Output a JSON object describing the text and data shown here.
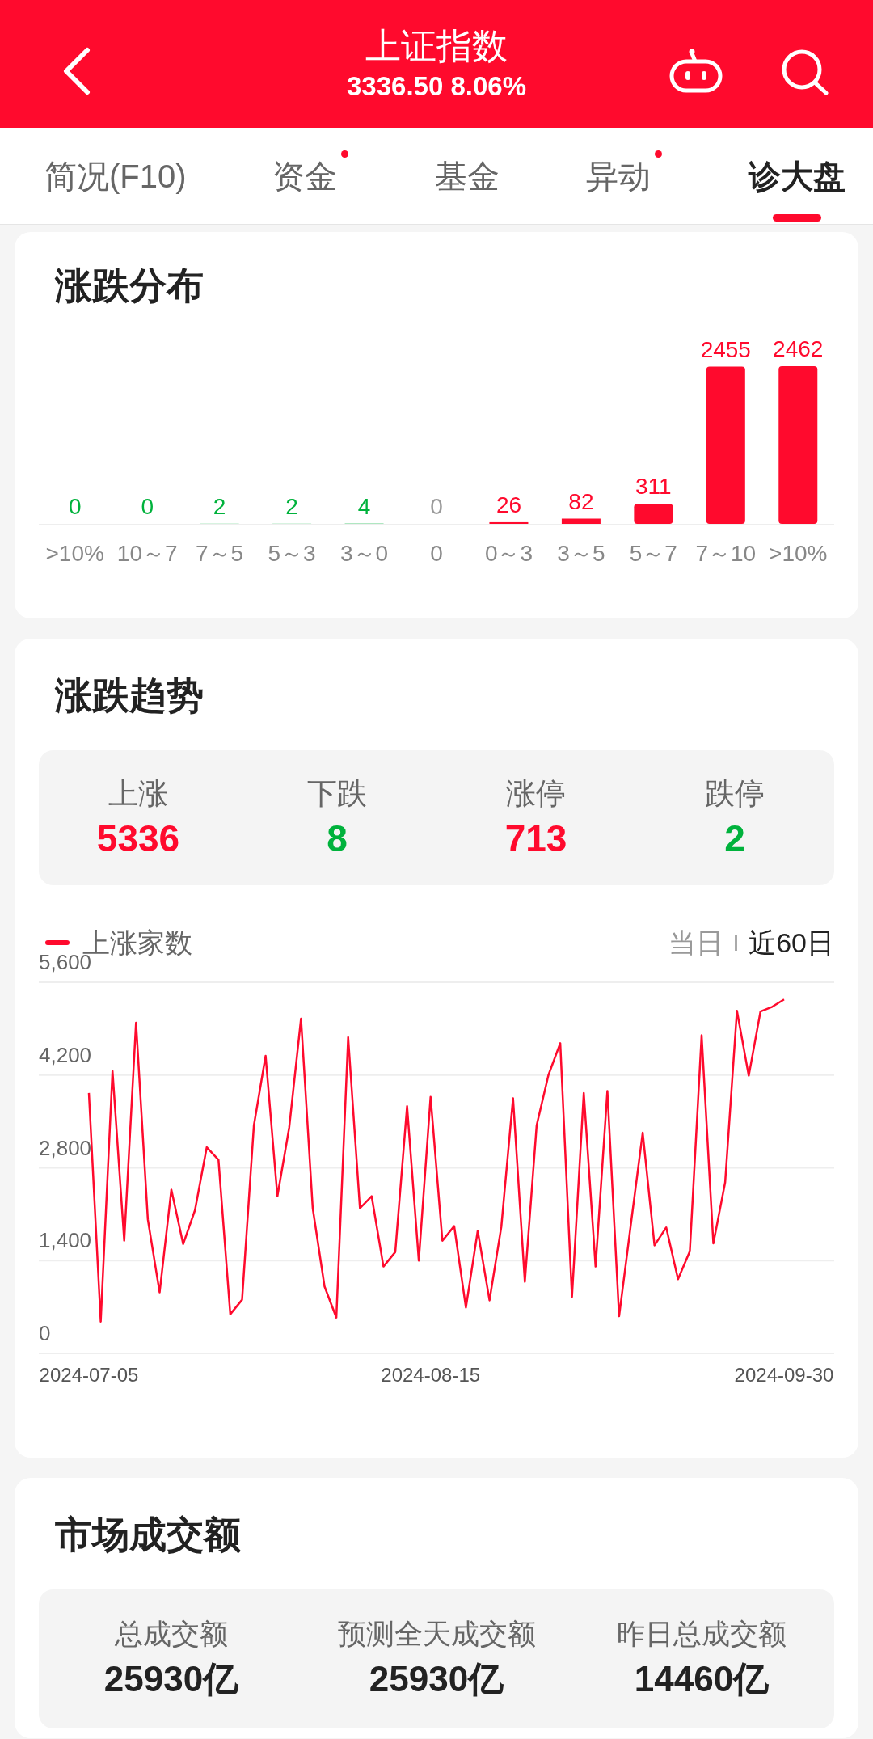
{
  "header": {
    "title": "上证指数",
    "quote": "3336.50 8.06%"
  },
  "tabs": [
    {
      "label": "简况(F10)",
      "selected": false,
      "dot": false
    },
    {
      "label": "资金",
      "selected": false,
      "dot": true
    },
    {
      "label": "基金",
      "selected": false,
      "dot": false
    },
    {
      "label": "异动",
      "selected": false,
      "dot": true
    },
    {
      "label": "诊大盘",
      "selected": true,
      "dot": false
    }
  ],
  "distribution": {
    "title": "涨跌分布",
    "chart_data": {
      "type": "bar",
      "categories": [
        ">10%",
        "10～7",
        "7～5",
        "5～3",
        "3～0",
        "0",
        "0～3",
        "3～5",
        "5～7",
        "7～10",
        ">10%"
      ],
      "data_labels": true,
      "series": [
        {
          "color": "#00b23c",
          "values": [
            0,
            0,
            2,
            2,
            4,
            null,
            null,
            null,
            null,
            null,
            null
          ]
        },
        {
          "color": "#999999",
          "values": [
            null,
            null,
            null,
            null,
            null,
            0,
            null,
            null,
            null,
            null,
            null
          ]
        },
        {
          "color": "#ff0a2d",
          "values": [
            null,
            null,
            null,
            null,
            null,
            null,
            26,
            82,
            311,
            2455,
            2462
          ]
        }
      ]
    }
  },
  "trend": {
    "title": "涨跌趋势",
    "stats": [
      {
        "label": "上涨",
        "value": "5336",
        "color": "#ff0a2d"
      },
      {
        "label": "下跌",
        "value": "8",
        "color": "#00b23c"
      },
      {
        "label": "涨停",
        "value": "713",
        "color": "#ff0a2d"
      },
      {
        "label": "跌停",
        "value": "2",
        "color": "#00b23c"
      }
    ],
    "ranges": [
      {
        "label": "当日",
        "selected": false
      },
      {
        "label": "近60日",
        "selected": true
      }
    ],
    "chart_data": {
      "type": "line",
      "grid": true,
      "ylim": [
        0,
        5600
      ],
      "yticks": [
        {
          "value": 0,
          "label": "0"
        },
        {
          "value": 1400,
          "label": "1,400"
        },
        {
          "value": 2800,
          "label": "2,800"
        },
        {
          "value": 4200,
          "label": "4,200"
        },
        {
          "value": 5600,
          "label": "5,600"
        }
      ],
      "categories": [
        "2024-07-05",
        null,
        null,
        null,
        null,
        null,
        null,
        null,
        null,
        null,
        null,
        null,
        null,
        null,
        null,
        null,
        null,
        null,
        null,
        null,
        null,
        null,
        null,
        null,
        null,
        null,
        null,
        null,
        null,
        "2024-08-15",
        null,
        null,
        null,
        null,
        null,
        null,
        null,
        null,
        null,
        null,
        null,
        null,
        null,
        null,
        null,
        null,
        null,
        null,
        null,
        null,
        null,
        null,
        null,
        null,
        null,
        null,
        null,
        null,
        null,
        "2024-09-30"
      ],
      "series": [
        {
          "name": "上涨家数",
          "color": "#ff0a2d",
          "values": [
            3930,
            480,
            4260,
            1700,
            4990,
            2020,
            920,
            2470,
            1650,
            2160,
            3110,
            2920,
            590,
            810,
            3440,
            4490,
            2370,
            3410,
            5050,
            2190,
            1010,
            540,
            4770,
            2190,
            2370,
            1310,
            1530,
            3730,
            1400,
            3870,
            1700,
            1920,
            690,
            1850,
            800,
            1910,
            3850,
            1080,
            3440,
            4200,
            4680,
            850,
            3930,
            1310,
            3960,
            560,
            1950,
            3330,
            1630,
            1900,
            1120,
            1540,
            4800,
            1660,
            2580,
            5170,
            4190,
            5160,
            5230,
            5340
          ]
        }
      ]
    }
  },
  "turnover": {
    "title": "市场成交额",
    "items": [
      {
        "label": "总成交额",
        "value": "25930亿"
      },
      {
        "label": "预测全天成交额",
        "value": "25930亿"
      },
      {
        "label": "昨日总成交额",
        "value": "14460亿"
      }
    ]
  }
}
